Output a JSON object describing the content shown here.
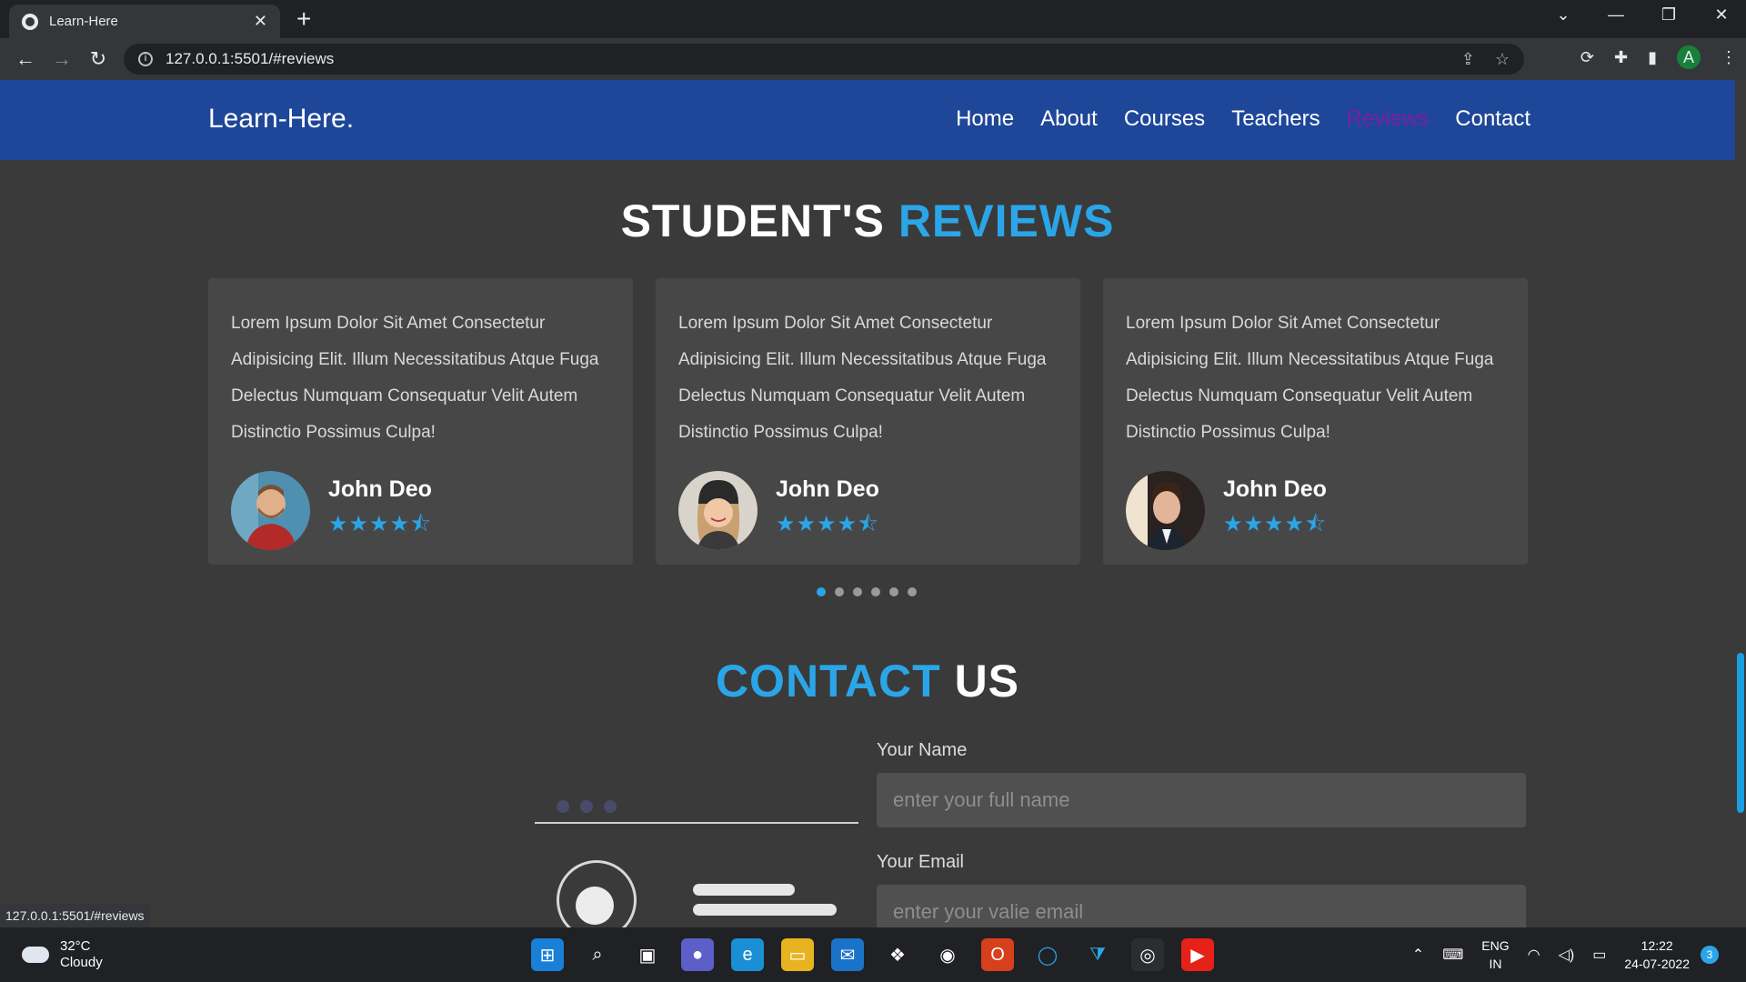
{
  "browser": {
    "tab_title": "Learn-Here",
    "url": "127.0.0.1:5501/#reviews",
    "profile_initial": "A",
    "status_url": "127.0.0.1:5501/#reviews"
  },
  "site": {
    "logo": "Learn-Here.",
    "nav": [
      "Home",
      "About",
      "Courses",
      "Teachers",
      "Reviews",
      "Contact"
    ],
    "active_nav": "Reviews"
  },
  "reviews": {
    "title_part1": "STUDENT'S",
    "title_part2": "REVIEWS",
    "cards": [
      {
        "text": "Lorem Ipsum Dolor Sit Amet Consectetur Adipisicing Elit. Illum Necessitatibus Atque Fuga Delectus Numquam Consequatur Velit Autem Distinctio Possimus Culpa!",
        "name": "John Deo",
        "rating": 4.5
      },
      {
        "text": "Lorem Ipsum Dolor Sit Amet Consectetur Adipisicing Elit. Illum Necessitatibus Atque Fuga Delectus Numquam Consequatur Velit Autem Distinctio Possimus Culpa!",
        "name": "John Deo",
        "rating": 4.5
      },
      {
        "text": "Lorem Ipsum Dolor Sit Amet Consectetur Adipisicing Elit. Illum Necessitatibus Atque Fuga Delectus Numquam Consequatur Velit Autem Distinctio Possimus Culpa!",
        "name": "John Deo",
        "rating": 4.5
      }
    ],
    "pagination": {
      "total": 6,
      "active": 1
    }
  },
  "contact": {
    "title_part1": "CONTACT",
    "title_part2": "US",
    "name_label": "Your Name",
    "name_placeholder": "enter your full name",
    "email_label": "Your Email",
    "email_placeholder": "enter your valie email"
  },
  "taskbar": {
    "temp": "32°C",
    "weather": "Cloudy",
    "lang1": "ENG",
    "lang2": "IN",
    "time": "12:22",
    "date": "24-07-2022",
    "notifications": "3"
  },
  "colors": {
    "header": "#1e4799",
    "accent": "#2aa6e8",
    "active_nav": "#7b1f9e",
    "background": "#3a3a3a",
    "card": "#474747"
  }
}
